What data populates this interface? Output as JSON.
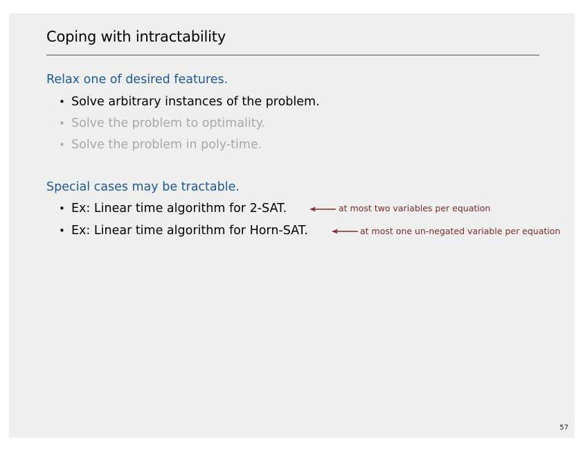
{
  "slide": {
    "title": "Coping with intractability",
    "section1": {
      "heading": "Relax one of desired features.",
      "bullets": [
        "Solve arbitrary instances of the problem.",
        "Solve the problem to optimality.",
        "Solve the problem in poly-time."
      ]
    },
    "section2": {
      "heading": "Special cases may be tractable.",
      "bullets": [
        "Ex:  Linear time algorithm for 2-SAT.",
        "Ex:  Linear time algorithm for Horn-SAT."
      ],
      "annotations": [
        "at most two variables per equation",
        "at most one un-negated variable per equation"
      ]
    },
    "bullet_glyph": "•",
    "page_number": "57"
  },
  "colors": {
    "heading": "#1d5a94",
    "dimmed": "#a8a8a8",
    "annotation": "#7a2b2b"
  }
}
